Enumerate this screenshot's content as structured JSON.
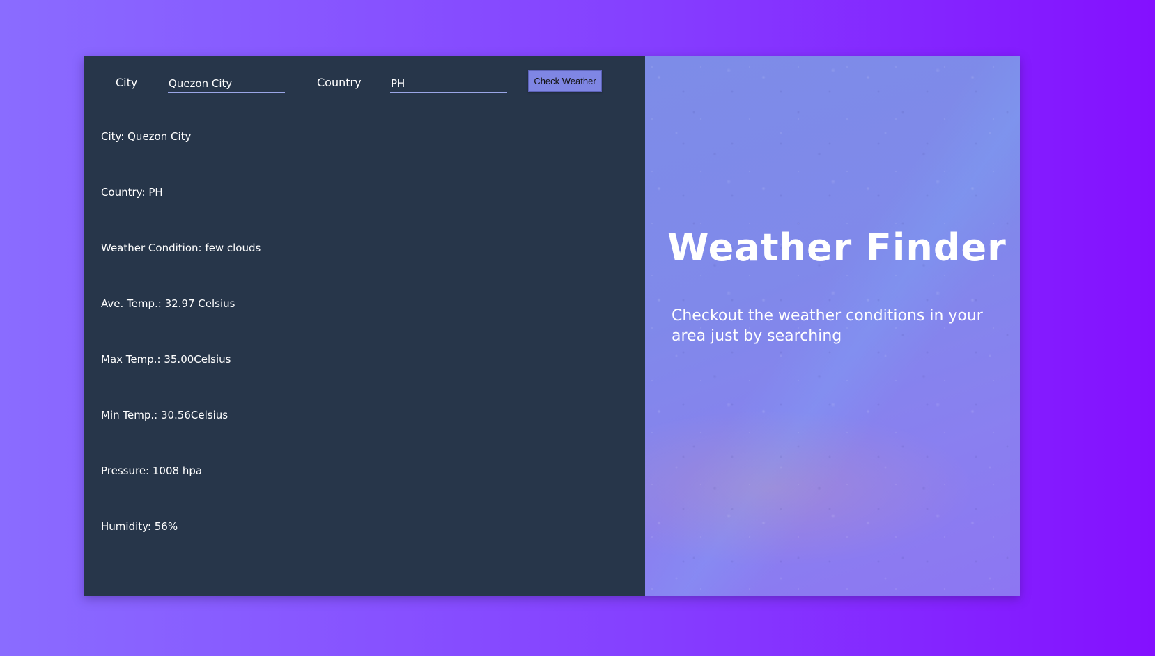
{
  "form": {
    "city_label": "City",
    "city_value": "Quezon City",
    "country_label": "Country",
    "country_value": "PH",
    "submit_label": "Check Weather"
  },
  "results": {
    "city": "City: Quezon City",
    "country": "Country: PH",
    "condition": "Weather Condition: few clouds",
    "ave_temp": "Ave. Temp.: 32.97 Celsius",
    "max_temp": "Max Temp.: 35.00Celsius",
    "min_temp": "Min Temp.: 30.56Celsius",
    "pressure": "Pressure: 1008 hpa",
    "humidity": "Humidity: 56%"
  },
  "hero": {
    "title": "Weather Finder",
    "subtitle": "Checkout the weather conditions in your area just by searching"
  },
  "colors": {
    "panel": "#27364a",
    "button": "#7f86e4",
    "background_start": "#8a6cff",
    "background_end": "#8410ff"
  }
}
